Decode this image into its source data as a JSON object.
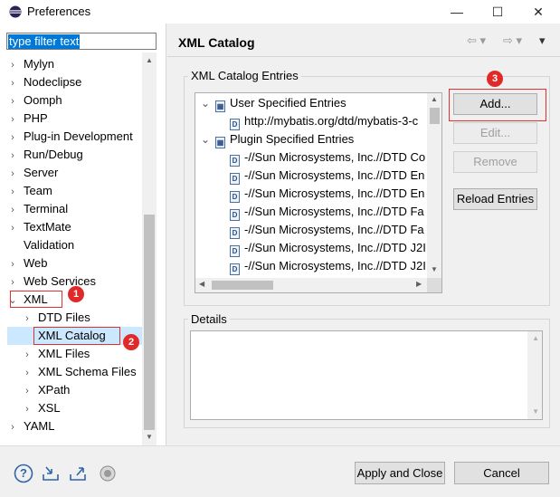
{
  "window": {
    "title": "Preferences",
    "minimize": "—",
    "maximize": "☐",
    "close": "✕"
  },
  "filter": {
    "text": "type filter text"
  },
  "tree": [
    {
      "label": "Mylyn",
      "level": 0,
      "twisty": "›"
    },
    {
      "label": "Nodeclipse",
      "level": 0,
      "twisty": "›"
    },
    {
      "label": "Oomph",
      "level": 0,
      "twisty": "›"
    },
    {
      "label": "PHP",
      "level": 0,
      "twisty": "›"
    },
    {
      "label": "Plug-in Development",
      "level": 0,
      "twisty": "›"
    },
    {
      "label": "Run/Debug",
      "level": 0,
      "twisty": "›"
    },
    {
      "label": "Server",
      "level": 0,
      "twisty": "›"
    },
    {
      "label": "Team",
      "level": 0,
      "twisty": "›"
    },
    {
      "label": "Terminal",
      "level": 0,
      "twisty": "›"
    },
    {
      "label": "TextMate",
      "level": 0,
      "twisty": "›"
    },
    {
      "label": "Validation",
      "level": 0,
      "twisty": ""
    },
    {
      "label": "Web",
      "level": 0,
      "twisty": "›"
    },
    {
      "label": "Web Services",
      "level": 0,
      "twisty": "›"
    },
    {
      "label": "XML",
      "level": 0,
      "twisty": "⌄"
    },
    {
      "label": "DTD Files",
      "level": 1,
      "twisty": "›"
    },
    {
      "label": "XML Catalog",
      "level": 1,
      "twisty": ""
    },
    {
      "label": "XML Files",
      "level": 1,
      "twisty": "›"
    },
    {
      "label": "XML Schema Files",
      "level": 1,
      "twisty": "›"
    },
    {
      "label": "XPath",
      "level": 1,
      "twisty": "›"
    },
    {
      "label": "XSL",
      "level": 1,
      "twisty": "›"
    },
    {
      "label": "YAML",
      "level": 0,
      "twisty": "›"
    }
  ],
  "callouts": {
    "one": "1",
    "two": "2",
    "three": "3"
  },
  "page": {
    "title": "XML Catalog",
    "back": "⇦ ▾",
    "forward": "⇨ ▾",
    "menu": "▾"
  },
  "entries": {
    "label": "XML Catalog Entries",
    "user": "User Specified Entries",
    "user_items": [
      "http://mybatis.org/dtd/mybatis-3-c"
    ],
    "plugin": "Plugin Specified Entries",
    "plugin_items": [
      "-//Sun Microsystems, Inc.//DTD Co",
      "-//Sun Microsystems, Inc.//DTD En",
      "-//Sun Microsystems, Inc.//DTD En",
      "-//Sun Microsystems, Inc.//DTD Fa",
      "-//Sun Microsystems, Inc.//DTD Fa",
      "-//Sun Microsystems, Inc.//DTD J2I",
      "-//Sun Microsystems, Inc.//DTD J2I"
    ],
    "file_icon": "D",
    "folder_icon": "▦"
  },
  "buttons": {
    "add": "Add...",
    "edit": "Edit...",
    "remove": "Remove",
    "reload": "Reload Entries"
  },
  "details": {
    "label": "Details"
  },
  "footer": {
    "apply_close": "Apply and Close",
    "cancel": "Cancel",
    "help": "?"
  }
}
